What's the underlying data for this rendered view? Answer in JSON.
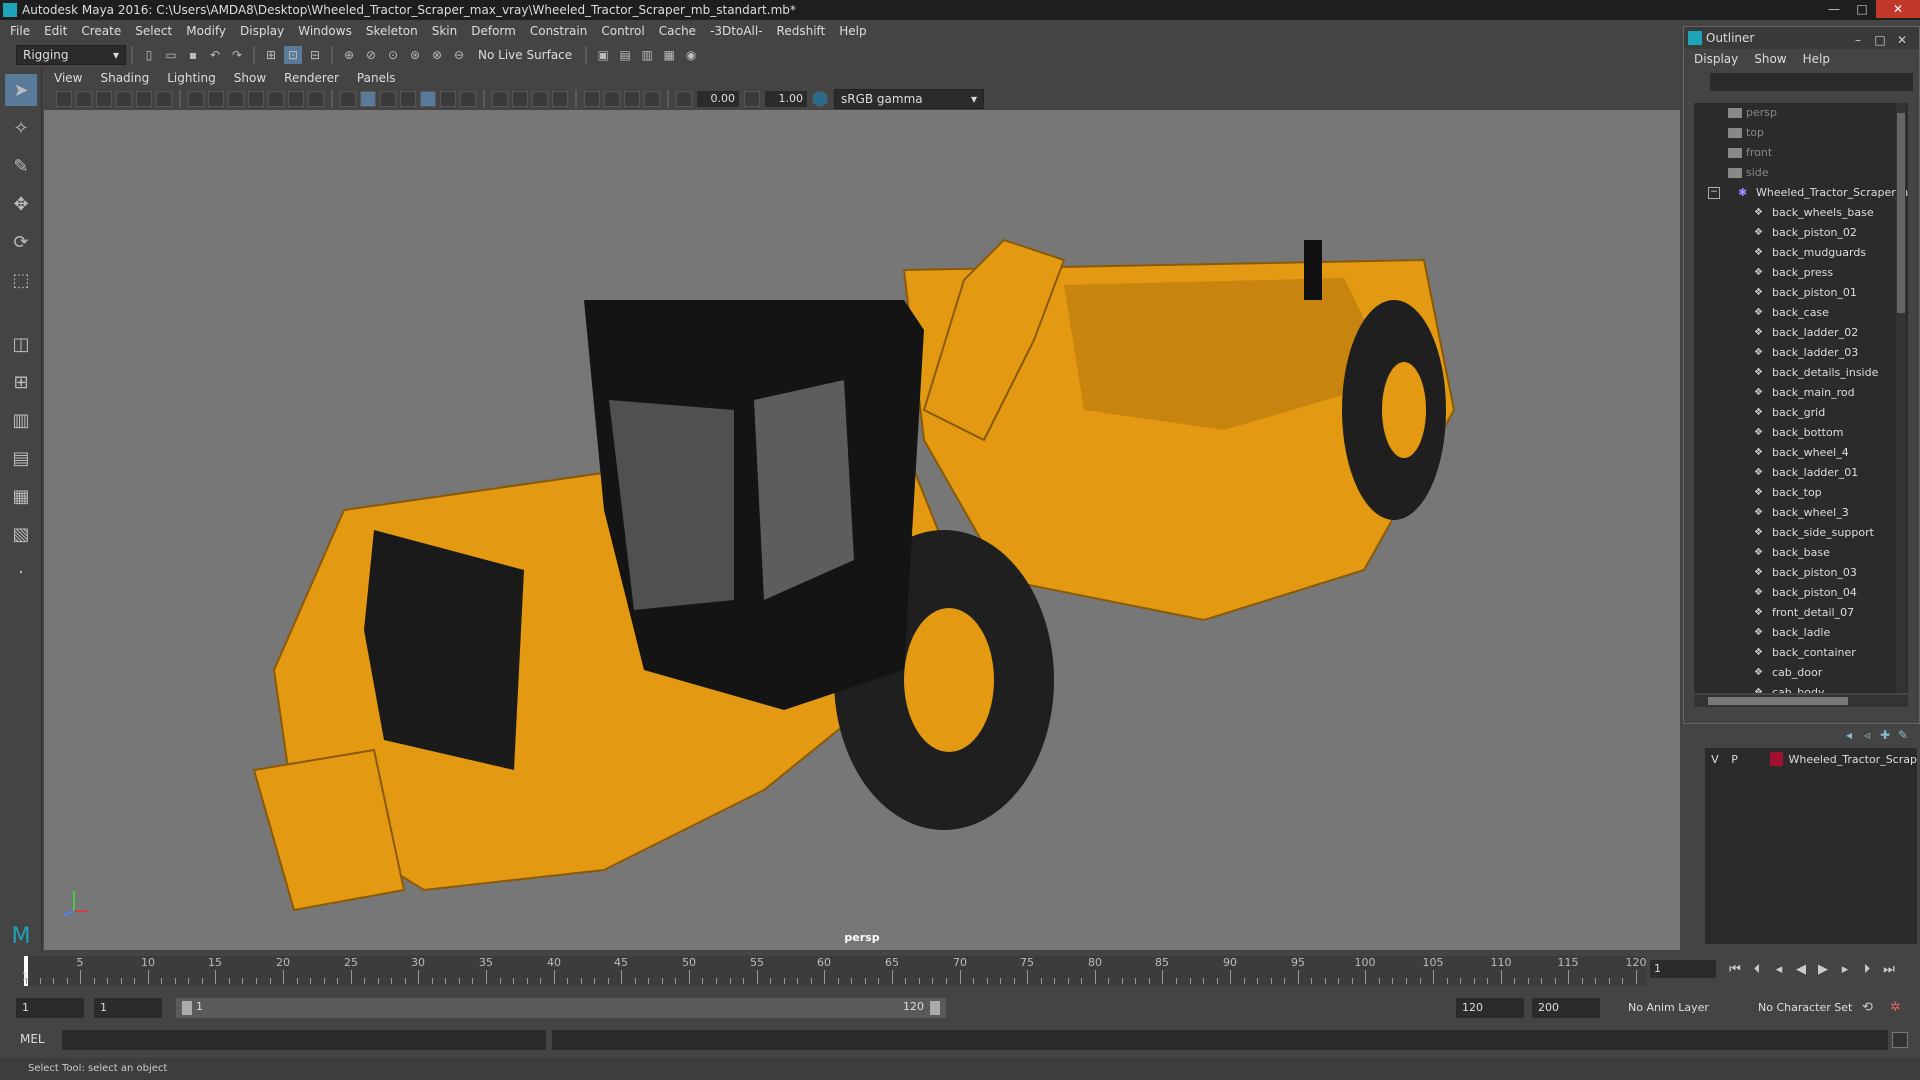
{
  "window": {
    "title": "Autodesk Maya 2016: C:\\Users\\AMDA8\\Desktop\\Wheeled_Tractor_Scraper_max_vray\\Wheeled_Tractor_Scraper_mb_standart.mb*",
    "min": "—",
    "max": "□",
    "close": "✕"
  },
  "menubar": [
    "File",
    "Edit",
    "Create",
    "Select",
    "Modify",
    "Display",
    "Windows",
    "Skeleton",
    "Skin",
    "Deform",
    "Constrain",
    "Control",
    "Cache",
    "-3DtoAll-",
    "Redshift",
    "Help"
  ],
  "statusline": {
    "mode": "Rigging",
    "live_surface": "No Live Surface"
  },
  "panel_menu": [
    "View",
    "Shading",
    "Lighting",
    "Show",
    "Renderer",
    "Panels"
  ],
  "panel_toolbar": {
    "field1": "0.00",
    "field2": "1.00",
    "colorspace": "sRGB gamma"
  },
  "viewport": {
    "camera_label": "persp",
    "model_color": "#e39a12",
    "background": "#777777"
  },
  "outliner": {
    "title": "Outliner",
    "menu": [
      "Display",
      "Show",
      "Help"
    ],
    "cameras": [
      "persp",
      "top",
      "front",
      "side"
    ],
    "group": "Wheeled_Tractor_Scraper_n",
    "children": [
      "back_wheels_base",
      "back_piston_02",
      "back_mudguards",
      "back_press",
      "back_piston_01",
      "back_case",
      "back_ladder_02",
      "back_ladder_03",
      "back_details_inside",
      "back_main_rod",
      "back_grid",
      "back_bottom",
      "back_wheel_4",
      "back_ladder_01",
      "back_top",
      "back_wheel_3",
      "back_side_support",
      "back_base",
      "back_piston_03",
      "back_piston_04",
      "front_detail_07",
      "back_ladle",
      "back_container",
      "cab_door",
      "cab_body"
    ]
  },
  "layers": {
    "v": "V",
    "p": "P",
    "name": "Wheeled_Tractor_Scrap",
    "color": "#a01030"
  },
  "timeline": {
    "ticks": [
      "5",
      "10",
      "15",
      "20",
      "25",
      "30",
      "35",
      "40",
      "45",
      "50",
      "55",
      "60",
      "65",
      "70",
      "75",
      "80",
      "85",
      "90",
      "95",
      "100",
      "105",
      "110",
      "115",
      "120"
    ],
    "start_marker": "1",
    "current_frame": "1"
  },
  "range": {
    "start": "1",
    "anim_start": "1",
    "slider_start": "1",
    "slider_end": "120",
    "end": "120",
    "anim_end": "200",
    "anim_layer": "No Anim Layer",
    "character_set": "No Character Set"
  },
  "command": {
    "label": "MEL"
  },
  "helpline": "Select Tool: select an object"
}
